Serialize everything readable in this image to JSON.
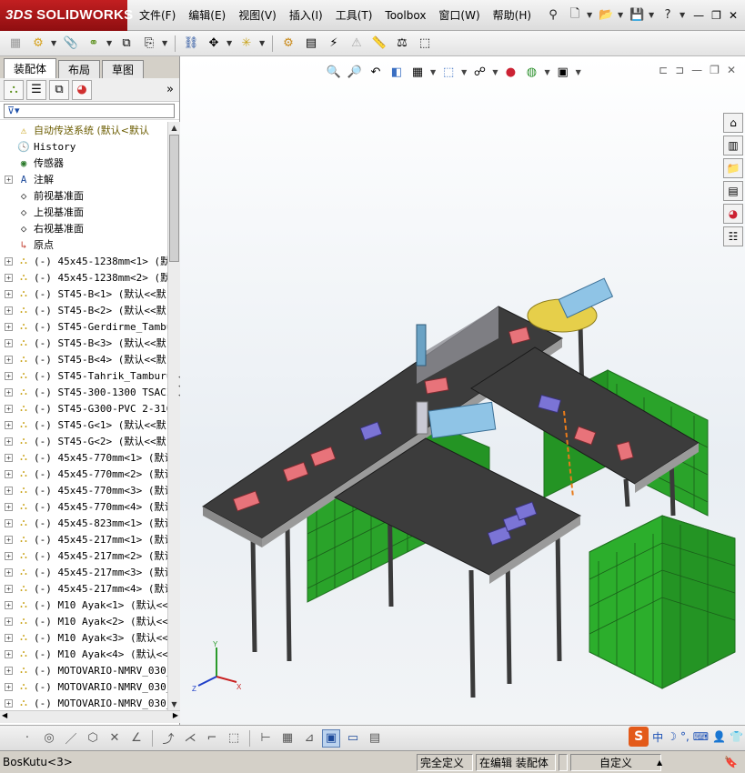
{
  "app": {
    "brand": "SOLIDWORKS",
    "brand_prefix": "3DS"
  },
  "menu": [
    "文件(F)",
    "编辑(E)",
    "视图(V)",
    "插入(I)",
    "工具(T)",
    "Toolbox",
    "窗口(W)",
    "帮助(H)"
  ],
  "help_glyph": "?",
  "tabs": [
    "装配体",
    "布局",
    "草图"
  ],
  "filter": {
    "icon": "filter-icon"
  },
  "tree": {
    "root": "自动传送系统  (默认<默认",
    "items": [
      {
        "label": "History",
        "icon": "history-icon",
        "expand": false
      },
      {
        "label": "传感器",
        "icon": "sensor-icon",
        "expand": false
      },
      {
        "label": "注解",
        "icon": "annotation-icon",
        "expand": true
      },
      {
        "label": "前视基准面",
        "icon": "plane-icon",
        "expand": false
      },
      {
        "label": "上视基准面",
        "icon": "plane-icon",
        "expand": false
      },
      {
        "label": "右视基准面",
        "icon": "plane-icon",
        "expand": false
      },
      {
        "label": "原点",
        "icon": "origin-icon",
        "expand": false
      },
      {
        "label": "(-) 45x45-1238mm<1> (默",
        "icon": "part-icon",
        "expand": true
      },
      {
        "label": "(-) 45x45-1238mm<2> (默",
        "icon": "part-icon",
        "expand": true
      },
      {
        "label": "(-) ST45-B<1> (默认<<默",
        "icon": "part-icon",
        "expand": true
      },
      {
        "label": "(-) ST45-B<2> (默认<<默",
        "icon": "part-icon",
        "expand": true
      },
      {
        "label": "(-) ST45-Gerdirme_Tambu",
        "icon": "part-icon",
        "expand": true
      },
      {
        "label": "(-) ST45-B<3> (默认<<默",
        "icon": "part-icon",
        "expand": true
      },
      {
        "label": "(-) ST45-B<4> (默认<<默",
        "icon": "part-icon",
        "expand": true
      },
      {
        "label": "(-) ST45-Tahrik_Tamburu",
        "icon": "part-icon",
        "expand": true
      },
      {
        "label": "(-) ST45-300-1300 TSACI",
        "icon": "part-icon",
        "expand": true
      },
      {
        "label": "(-) ST45-G300-PVC 2-316",
        "icon": "part-icon",
        "expand": true
      },
      {
        "label": "(-) ST45-G<1> (默认<<默",
        "icon": "part-icon",
        "expand": true
      },
      {
        "label": "(-) ST45-G<2> (默认<<默",
        "icon": "part-icon",
        "expand": true
      },
      {
        "label": "(-) 45x45-770mm<1> (默认",
        "icon": "part-icon",
        "expand": true
      },
      {
        "label": "(-) 45x45-770mm<2> (默认",
        "icon": "part-icon",
        "expand": true
      },
      {
        "label": "(-) 45x45-770mm<3> (默认",
        "icon": "part-icon",
        "expand": true
      },
      {
        "label": "(-) 45x45-770mm<4> (默认",
        "icon": "part-icon",
        "expand": true
      },
      {
        "label": "(-) 45x45-823mm<1> (默认",
        "icon": "part-icon",
        "expand": true
      },
      {
        "label": "(-) 45x45-217mm<1> (默认",
        "icon": "part-icon",
        "expand": true
      },
      {
        "label": "(-) 45x45-217mm<2> (默认",
        "icon": "part-icon",
        "expand": true
      },
      {
        "label": "(-) 45x45-217mm<3> (默认",
        "icon": "part-icon",
        "expand": true
      },
      {
        "label": "(-) 45x45-217mm<4> (默认",
        "icon": "part-icon",
        "expand": true
      },
      {
        "label": "(-) M10 Ayak<1> (默认<<",
        "icon": "part-icon",
        "expand": true
      },
      {
        "label": "(-) M10 Ayak<2> (默认<<",
        "icon": "part-icon",
        "expand": true
      },
      {
        "label": "(-) M10 Ayak<3> (默认<<",
        "icon": "part-icon",
        "expand": true
      },
      {
        "label": "(-) M10 Ayak<4> (默认<<",
        "icon": "part-icon",
        "expand": true
      },
      {
        "label": "(-) MOTOVARIO-NMRV_030_",
        "icon": "part-icon",
        "expand": true
      },
      {
        "label": "(-) MOTOVARIO-NMRV_030_",
        "icon": "part-icon",
        "expand": true
      },
      {
        "label": "(-) MOTOVARIO-NMRV_030_",
        "icon": "part-icon",
        "expand": true
      }
    ]
  },
  "triad": {
    "x": "X",
    "y": "Y",
    "z": "Z"
  },
  "ime": {
    "logo": "S",
    "lang": "中"
  },
  "status": {
    "document": "BosKutu<3>",
    "definition": "完全定义",
    "mode": "在编辑 装配体",
    "units": "自定义",
    "caret": "▲"
  },
  "colors": {
    "accent": "#c21f21",
    "frame": "#3a3a3a",
    "bin": "#2aa32a",
    "box_red": "#e8737a",
    "box_blue": "#7b74d6"
  }
}
